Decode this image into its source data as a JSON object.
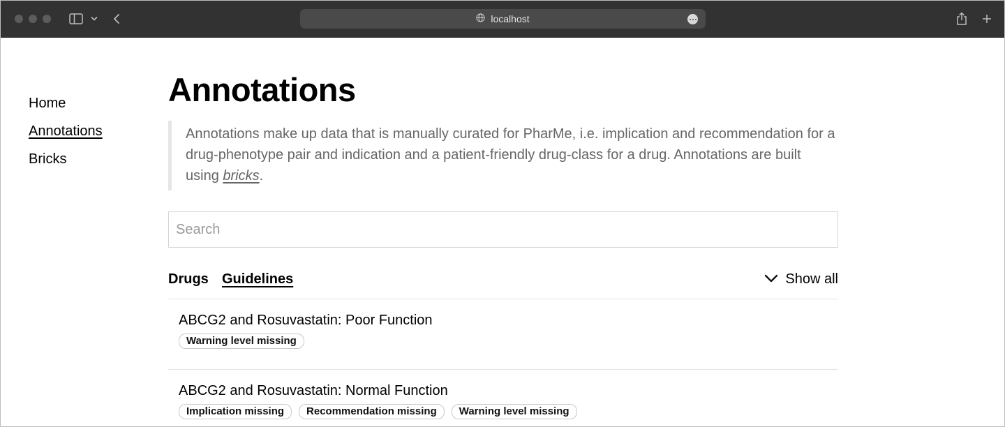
{
  "browser": {
    "url": "localhost",
    "icons": {
      "sidebar": "sidebar-toggle-icon",
      "chevron": "chevron-down-icon",
      "back": "back-arrow-icon",
      "site": "globe-icon",
      "more": "ellipsis-circle-icon",
      "share": "share-icon",
      "new_tab": "plus-icon"
    }
  },
  "sidebar": {
    "items": [
      {
        "label": "Home",
        "active": false
      },
      {
        "label": "Annotations",
        "active": true
      },
      {
        "label": "Bricks",
        "active": false
      }
    ]
  },
  "main": {
    "title": "Annotations",
    "description": {
      "text": "Annotations make up data that is manually curated for PharMe, i.e. implication and recommendation for a drug-phenotype pair and indication and a patient-friendly drug-class for a drug. Annotations are built using ",
      "link": "bricks",
      "suffix": "."
    },
    "search": {
      "placeholder": "Search",
      "value": ""
    },
    "tabs": [
      {
        "label": "Drugs",
        "active": false
      },
      {
        "label": "Guidelines",
        "active": true
      }
    ],
    "show_all": {
      "label": "Show all",
      "icon": "chevron-down-icon"
    },
    "items": [
      {
        "title": "ABCG2 and Rosuvastatin: Poor Function",
        "badges": [
          "Warning level missing"
        ]
      },
      {
        "title": "ABCG2 and Rosuvastatin: Normal Function",
        "badges": [
          "Implication missing",
          "Recommendation missing",
          "Warning level missing"
        ]
      }
    ]
  },
  "colors": {
    "toolbar": "#323232",
    "urlbar": "#4a4a4a",
    "quote_border": "#e6e6e6",
    "quote_text": "#666666",
    "divider": "#e2e2e2",
    "badge_border": "#c9c9c9"
  }
}
